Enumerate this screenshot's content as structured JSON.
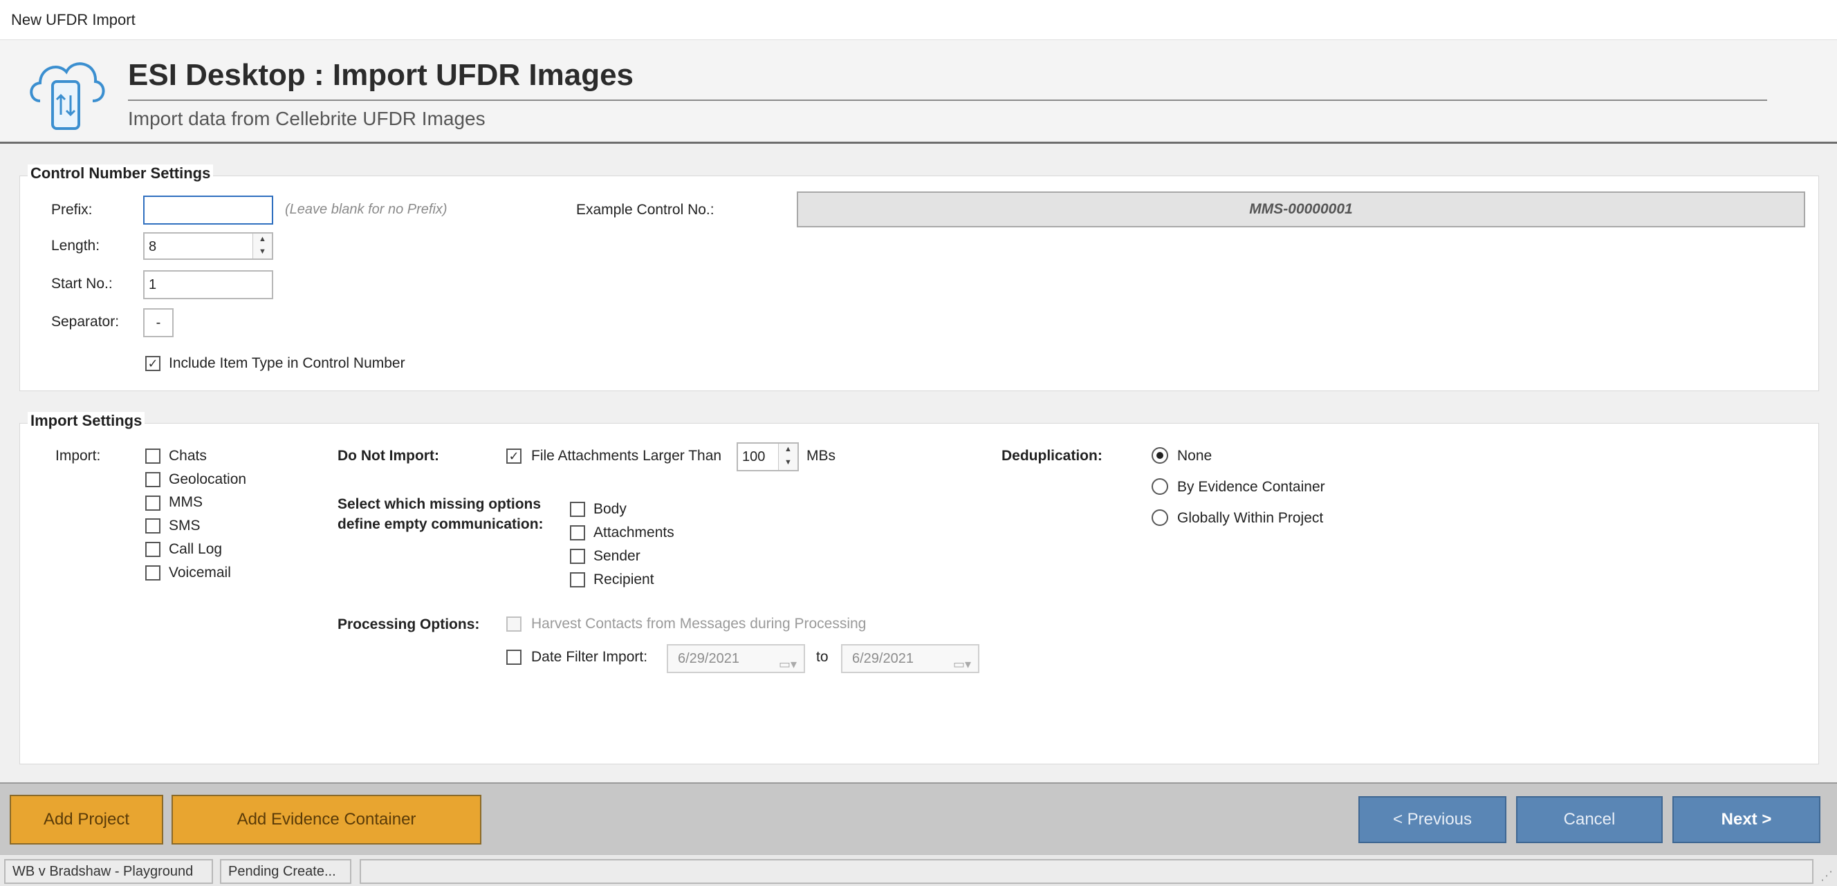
{
  "window": {
    "title": "New UFDR Import"
  },
  "header": {
    "title": "ESI Desktop : Import UFDR Images",
    "subtitle": "Import data from Cellebrite UFDR Images",
    "logo_icon": "cloud-phone-sync-icon"
  },
  "control_number": {
    "group_label": "Control Number Settings",
    "prefix_label": "Prefix:",
    "prefix_value": "",
    "prefix_hint": "(Leave blank for no Prefix)",
    "length_label": "Length:",
    "length_value": "8",
    "start_label": "Start No.:",
    "start_value": "1",
    "separator_label": "Separator:",
    "separator_value": "-",
    "include_type_label": "Include Item Type in Control Number",
    "include_type_checked": true,
    "example_label": "Example Control No.:",
    "example_value": "MMS-00000001"
  },
  "import_settings": {
    "group_label": "Import Settings",
    "import_label": "Import:",
    "import_items": [
      {
        "label": "Chats",
        "checked": false
      },
      {
        "label": "Geolocation",
        "checked": false
      },
      {
        "label": "MMS",
        "checked": false
      },
      {
        "label": "SMS",
        "checked": false
      },
      {
        "label": "Call Log",
        "checked": false
      },
      {
        "label": "Voicemail",
        "checked": false
      }
    ],
    "do_not_import_label": "Do Not Import:",
    "file_attach_label": "File Attachments Larger Than",
    "file_attach_checked": true,
    "file_attach_value": "100",
    "file_attach_unit": "MBs",
    "missing_label_line1": "Select which missing options",
    "missing_label_line2": "define empty communication:",
    "missing_items": [
      {
        "label": "Body",
        "checked": false
      },
      {
        "label": "Attachments",
        "checked": false
      },
      {
        "label": "Sender",
        "checked": false
      },
      {
        "label": "Recipient",
        "checked": false
      }
    ],
    "processing_label": "Processing Options:",
    "harvest_label": "Harvest Contacts from Messages during Processing",
    "date_filter_label": "Date Filter Import:",
    "date_from": "6/29/2021",
    "date_to_label": "to",
    "date_to": "6/29/2021",
    "dedup_label": "Deduplication:",
    "dedup_options": [
      {
        "label": "None",
        "selected": true
      },
      {
        "label": "By Evidence Container",
        "selected": false
      },
      {
        "label": "Globally Within Project",
        "selected": false
      }
    ]
  },
  "footer": {
    "add_project": "Add Project",
    "add_evidence": "Add Evidence Container",
    "previous": "< Previous",
    "cancel": "Cancel",
    "next": "Next >"
  },
  "status": {
    "project": "WB v Bradshaw - Playground",
    "pending": "Pending Create..."
  },
  "colors": {
    "accent_orange": "#e8a530",
    "nav_blue": "#5a86b5"
  }
}
